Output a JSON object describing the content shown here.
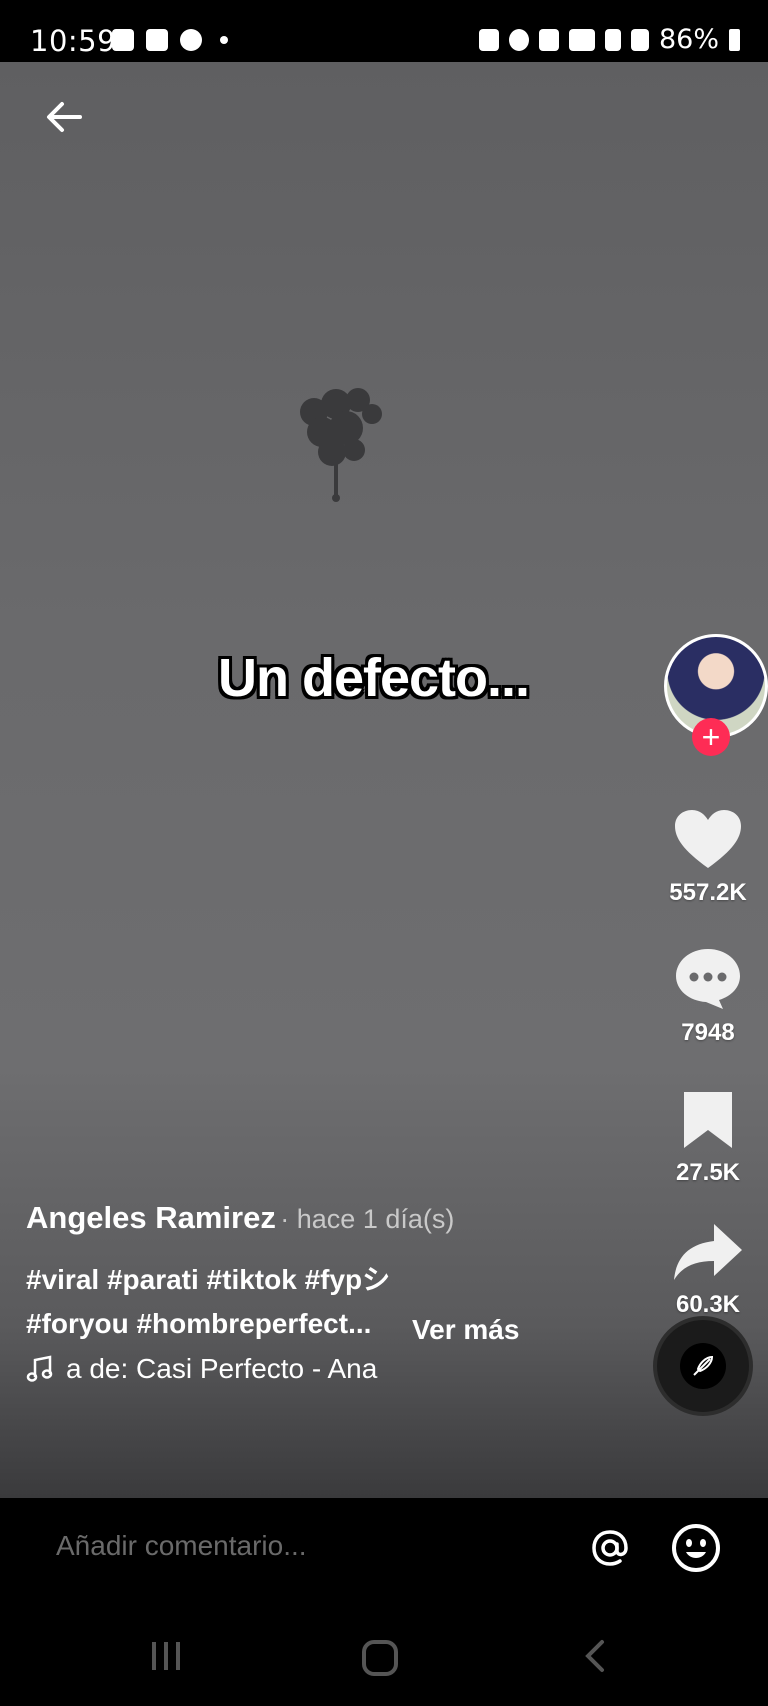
{
  "status_bar": {
    "time": "10:59",
    "battery": "86%"
  },
  "video": {
    "overlay_text": "Un defecto..."
  },
  "actions": {
    "likes": "557.2K",
    "comments": "7948",
    "saves": "27.5K",
    "shares": "60.3K"
  },
  "caption": {
    "author": "Angeles Ramirez",
    "time_ago": "· hace 1 día(s)",
    "tags_line1": "#viral #parati #tiktok #fypシ",
    "tags_line2": "#foryou #hombreperfect...",
    "see_more": "Ver más",
    "music": "a de: Casi Perfecto - Ana"
  },
  "comment_bar": {
    "placeholder": "Añadir comentario..."
  },
  "colors": {
    "follow": "#fe2c55",
    "accent": "#ffffff"
  }
}
